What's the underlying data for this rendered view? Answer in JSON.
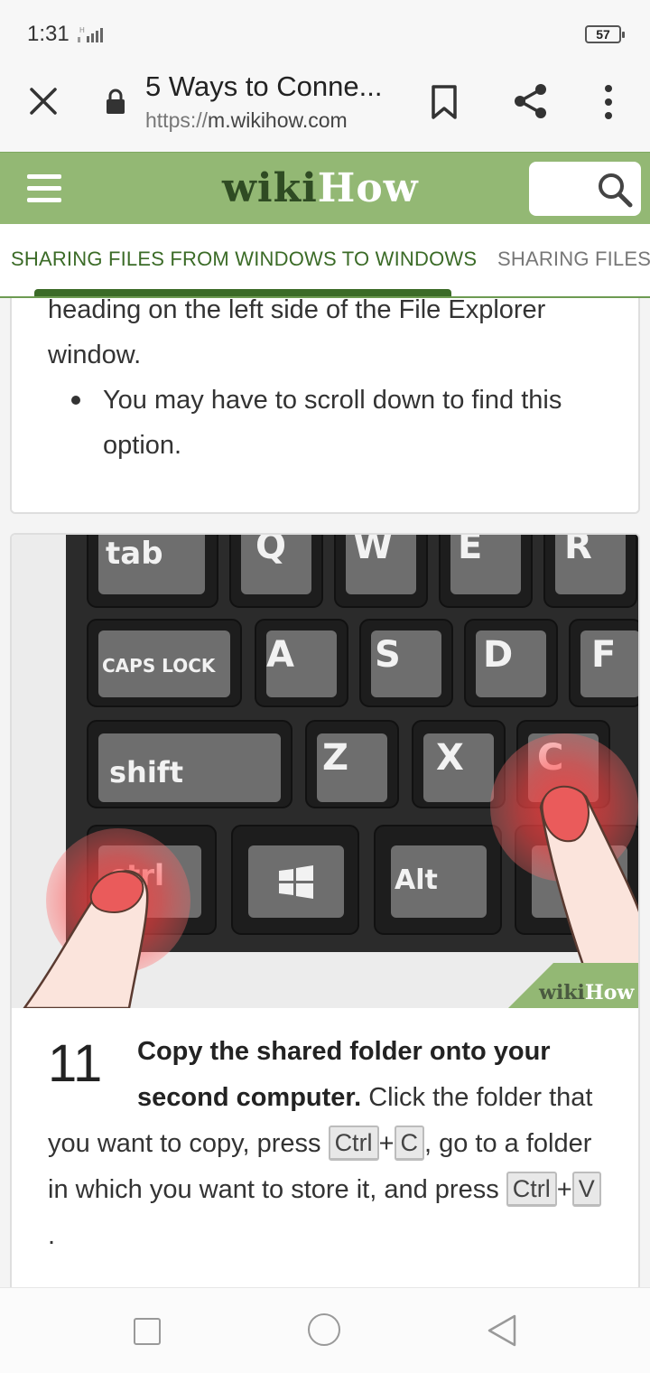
{
  "status_bar": {
    "time": "1:31",
    "battery": "57"
  },
  "browser": {
    "title": "5 Ways to Conne...",
    "url_protocol": "https://",
    "url_host": "m.wikihow.com"
  },
  "header": {
    "logo_part1": "wiki",
    "logo_part2": "How"
  },
  "tabs": [
    {
      "label": "SHARING FILES FROM WINDOWS TO WINDOWS",
      "active": true
    },
    {
      "label": "SHARING FILES",
      "active": false
    }
  ],
  "prev_step": {
    "text": "heading on the left side of the File Explorer window.",
    "bullet": "You may have to scroll down to find this option."
  },
  "illustration": {
    "keys": [
      "tab",
      "Q",
      "W",
      "E",
      "R",
      "CAPS LOCK",
      "A",
      "S",
      "D",
      "F",
      "shift",
      "Z",
      "X",
      "C",
      "ctrl",
      "Alt"
    ],
    "watermark_part1": "wiki",
    "watermark_part2": "How"
  },
  "step": {
    "number": "11",
    "bold": "Copy the shared folder onto your second computer.",
    "text_1": " Click the folder that you want to copy, press ",
    "key_ctrl": "Ctrl",
    "plus": "+",
    "key_c": "C",
    "text_2": ", go to a folder in which you want to store it, and press ",
    "key_v": "V",
    "text_3": "."
  },
  "colors": {
    "header_green": "#93b874",
    "tab_active": "#3b6b27",
    "logo_dark": "#2f4b23"
  },
  "icons": [
    "close-icon",
    "lock-icon",
    "bookmark-icon",
    "share-icon",
    "more-vert-icon",
    "hamburger-icon",
    "search-icon",
    "recent-apps-icon",
    "home-icon",
    "back-icon"
  ]
}
